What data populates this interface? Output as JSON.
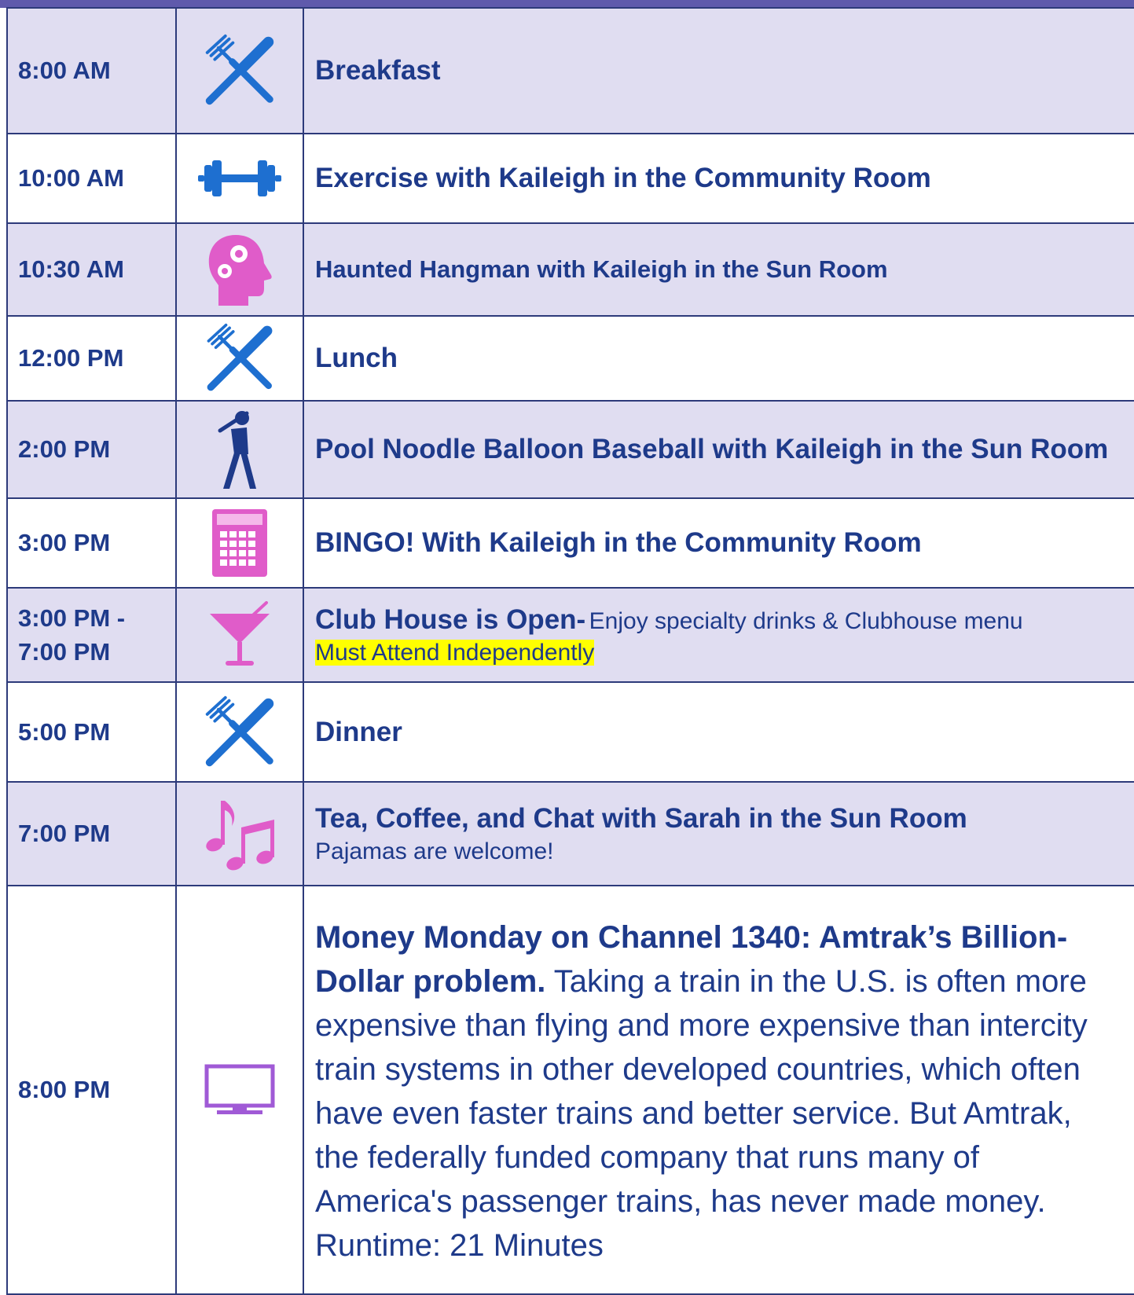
{
  "rows": [
    {
      "time": "8:00 AM",
      "icon": "fork-knife-icon",
      "title": "Breakfast"
    },
    {
      "time": "10:00 AM",
      "icon": "dumbbell-icon",
      "title": "Exercise with Kaileigh in the Community Room"
    },
    {
      "time": "10:30 AM",
      "icon": "brain-gears-icon",
      "title": "Haunted Hangman with Kaileigh in the Sun Room"
    },
    {
      "time": "12:00 PM",
      "icon": "fork-knife-icon",
      "title": "Lunch"
    },
    {
      "time": "2:00 PM",
      "icon": "baseball-batter-icon",
      "title": "Pool Noodle Balloon Baseball with Kaileigh in the Sun Room"
    },
    {
      "time": "3:00 PM",
      "icon": "bingo-card-icon",
      "title": "BINGO! With Kaileigh in the Community Room"
    },
    {
      "time_line1": "3:00 PM -",
      "time_line2": "7:00 PM",
      "icon": "cocktail-icon",
      "title": "Club House is Open-",
      "detail": "Enjoy specialty drinks & Clubhouse menu",
      "highlight": "Must Attend Independently"
    },
    {
      "time": "5:00 PM",
      "icon": "fork-knife-icon",
      "title": "Dinner"
    },
    {
      "time": "7:00 PM",
      "icon": "music-notes-icon",
      "title": "Tea, Coffee, and Chat with Sarah in the Sun Room",
      "detail": "Pajamas are welcome!"
    },
    {
      "time": "8:00 PM",
      "icon": "television-icon",
      "title": "Money Monday on Channel 1340: Amtrak’s Billion-Dollar problem.",
      "detail": "Taking a train in the U.S. is often more expensive than flying and more expensive than intercity train systems in other developed countries, which often have even faster trains and better service. But Amtrak, the federally funded company that runs many of America's passenger trains, has never made money. Runtime: 21 Minutes"
    }
  ],
  "colors": {
    "header_bar": "#5f5aac",
    "shade": "#e0ddf1",
    "text": "#1e3a8a",
    "icon_blue": "#1e6fd0",
    "icon_pink": "#e05cc9",
    "icon_purple": "#a05ad6"
  }
}
